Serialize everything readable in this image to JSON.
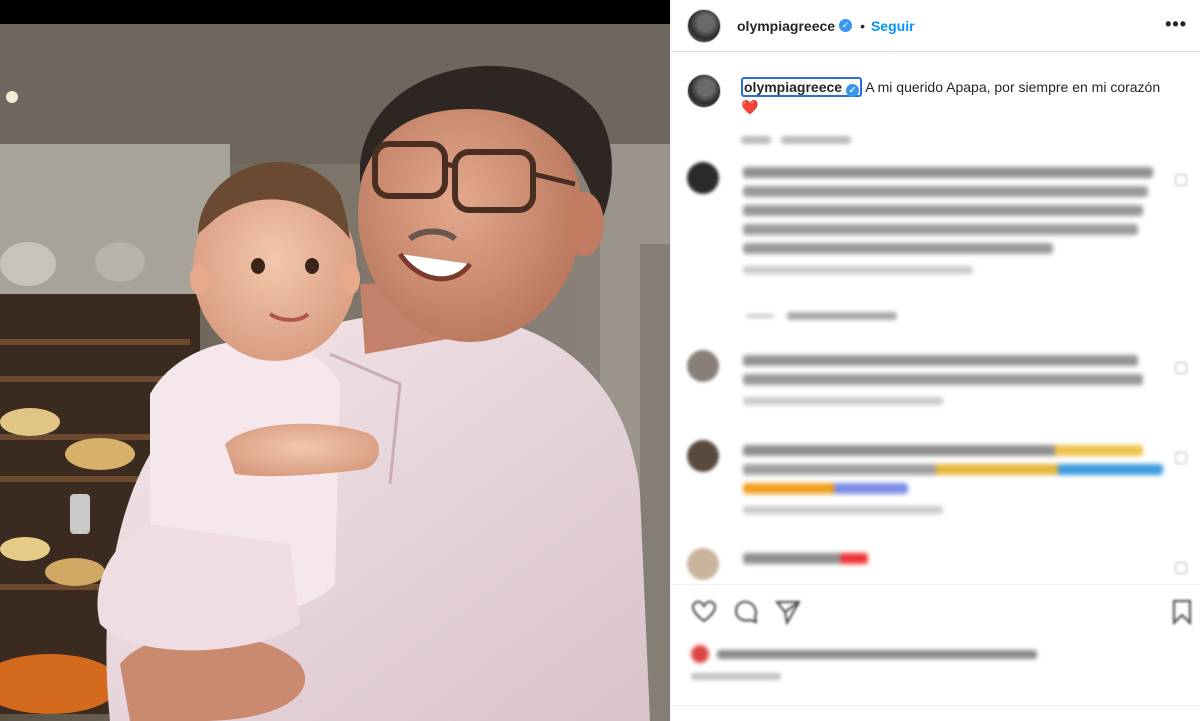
{
  "post": {
    "username": "olympiagreece",
    "follow_label": "Seguir",
    "more_icon": "•••",
    "separator": "•",
    "caption_text": "A mi querido Apapa, por siempre en mi corazón",
    "caption_emoji": "❤️",
    "verified_icon": "✓"
  },
  "colors": {
    "accent": "#0095f6",
    "verified": "#3897f0",
    "heart": "#e0121f",
    "focus_ring": "#2a6ee0"
  },
  "icons": {
    "like": "heart-outline-icon",
    "comment": "comment-bubble-icon",
    "share": "paper-plane-icon",
    "save": "bookmark-icon",
    "more": "ellipsis-icon"
  }
}
